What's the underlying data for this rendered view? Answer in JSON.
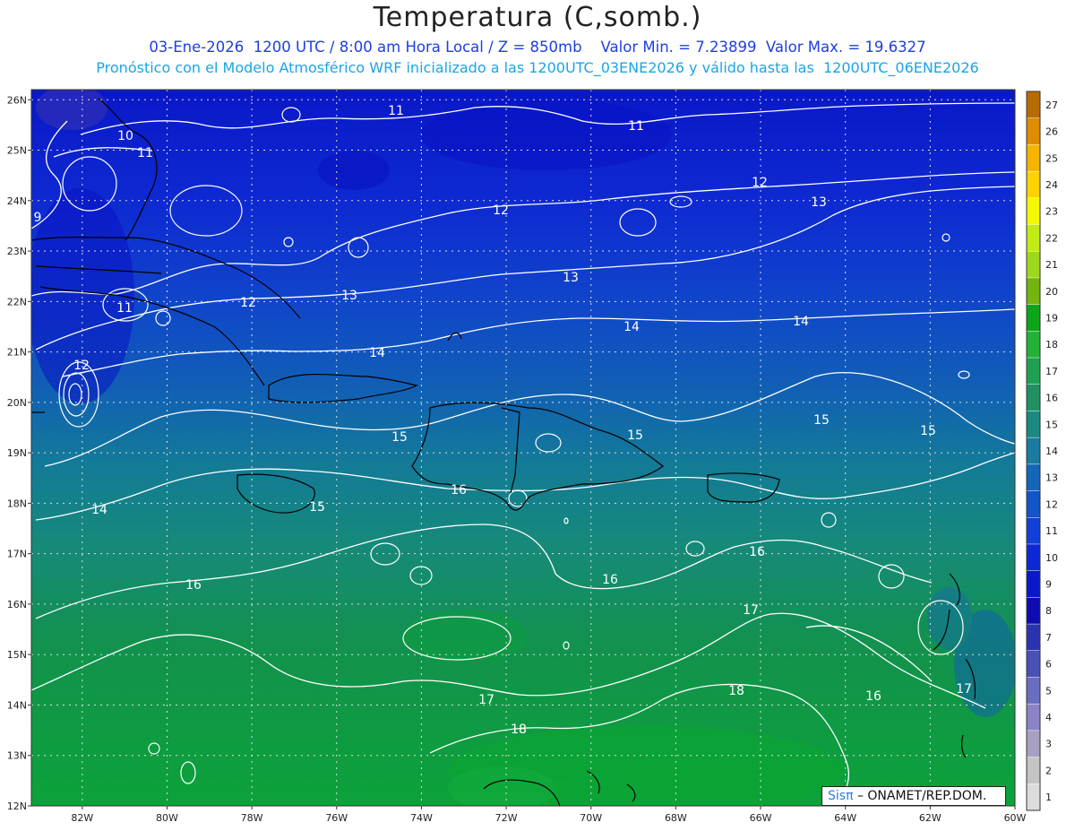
{
  "header": {
    "title": "Temperatura (C,somb.)",
    "line1": "03-Ene-2026  1200 UTC / 8:00 am Hora Local / Z = 850mb    Valor Min. = 7.23899  Valor Max. = 19.6327",
    "line2": "Pronóstico con el Modelo Atmosférico WRF inicializado a las 1200UTC_03ENE2026 y válido hasta las  1200UTC_06ENE2026"
  },
  "map": {
    "lat_labels": [
      "26N",
      "25N",
      "24N",
      "23N",
      "22N",
      "21N",
      "20N",
      "19N",
      "18N",
      "17N",
      "16N",
      "15N",
      "14N",
      "13N",
      "12N"
    ],
    "lon_labels": [
      "82W",
      "80W",
      "78W",
      "76W",
      "74W",
      "72W",
      "70W",
      "68W",
      "66W",
      "64W",
      "62W",
      "60W"
    ],
    "contour_labels": [
      "11",
      "10",
      "11",
      "9",
      "11",
      "12",
      "11",
      "12",
      "12",
      "13",
      "13",
      "12",
      "13",
      "14",
      "14",
      "14",
      "15",
      "15",
      "15",
      "16",
      "15",
      "14",
      "15",
      "16",
      "16",
      "16",
      "17",
      "17",
      "17",
      "18",
      "18",
      "16"
    ],
    "colors": {
      "cold": "#0a1ad8",
      "mid": "#1166b0",
      "warm": "#0a9a3a",
      "contour": "#ffffff",
      "coast": "#000000"
    }
  },
  "colorbar": {
    "values": [
      "27",
      "26",
      "25",
      "24",
      "23",
      "22",
      "21",
      "20",
      "19",
      "18",
      "17",
      "16",
      "15",
      "14",
      "13",
      "12",
      "11",
      "10",
      "9",
      "8",
      "7",
      "6",
      "5",
      "4",
      "3",
      "2",
      "1"
    ],
    "colors": [
      "#b86c00",
      "#e08c00",
      "#f4b400",
      "#ffd200",
      "#f4f800",
      "#c2ea16",
      "#9ed81c",
      "#74b40e",
      "#0ea41a",
      "#22b238",
      "#1ea052",
      "#1f9162",
      "#1a8a80",
      "#1a7aa0",
      "#1366b8",
      "#1354c8",
      "#1040d6",
      "#0c28d4",
      "#0a18c8",
      "#0c0cb0",
      "#2a34b0",
      "#4852b6",
      "#6a6ec0",
      "#8a84c6",
      "#a8a0c0",
      "#c4c4c4",
      "#dcdcdc"
    ]
  },
  "credit": {
    "brand": "Sisπ",
    "text": "– ONAMET/REP.DOM."
  }
}
